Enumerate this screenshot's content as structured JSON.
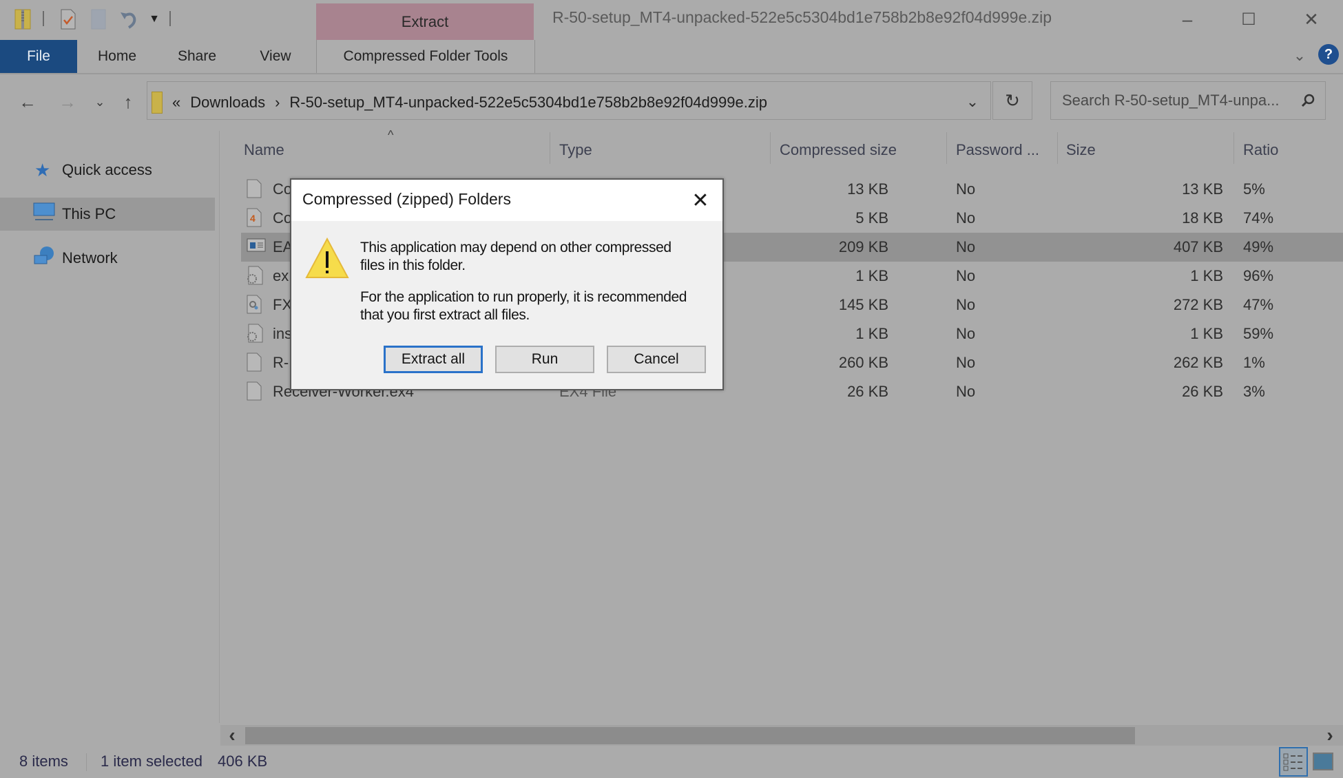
{
  "window": {
    "title": "R-50-setup_MT4-unpacked-522e5c5304bd1e758b2b8e92f04d999e.zip",
    "contextual_tab_group": "Extract",
    "controls": {
      "minimize": "–",
      "maximize": "☐",
      "close": "✕"
    }
  },
  "quick_access_toolbar": {
    "icons": [
      "zip-folder-icon",
      "properties-icon",
      "new-folder-icon",
      "undo-icon",
      "customize-dropdown-icon"
    ]
  },
  "ribbon": {
    "tabs": [
      {
        "label": "File",
        "active": true
      },
      {
        "label": "Home"
      },
      {
        "label": "Share"
      },
      {
        "label": "View"
      },
      {
        "label": "Compressed Folder Tools"
      }
    ],
    "expand_glyph": "⌄",
    "help_glyph": "?"
  },
  "navigation": {
    "back": "←",
    "forward": "→",
    "recent": "⌄",
    "up": "↑"
  },
  "address_bar": {
    "overflow": "«",
    "breadcrumbs": [
      "Downloads",
      "R-50-setup_MT4-unpacked-522e5c5304bd1e758b2b8e92f04d999e.zip"
    ],
    "separator": "›",
    "dropdown_glyph": "⌄",
    "refresh_glyph": "↻"
  },
  "search": {
    "placeholder": "Search R-50-setup_MT4-unpa...",
    "icon_glyph": "⚲"
  },
  "sidebar": {
    "items": [
      {
        "label": "Quick access",
        "icon": "star-icon"
      },
      {
        "label": "This PC",
        "icon": "computer-icon",
        "selected": true
      },
      {
        "label": "Network",
        "icon": "network-icon"
      }
    ]
  },
  "file_list": {
    "sort_indicator": "^",
    "columns": [
      "Name",
      "Type",
      "Compressed size",
      "Password ...",
      "Size",
      "Ratio"
    ],
    "rows": [
      {
        "name": "Co",
        "type": "",
        "compressed": "13 KB",
        "password": "No",
        "size": "13 KB",
        "ratio": "5%",
        "icon": "file-icon"
      },
      {
        "name": "Co",
        "type": "",
        "compressed": "5 KB",
        "password": "No",
        "size": "18 KB",
        "ratio": "74%",
        "icon": "mq4-file-icon"
      },
      {
        "name": "EA",
        "type": "",
        "compressed": "209 KB",
        "password": "No",
        "size": "407 KB",
        "ratio": "49%",
        "icon": "application-icon",
        "selected": true
      },
      {
        "name": "ex",
        "type": "",
        "compressed": "1 KB",
        "password": "No",
        "size": "1 KB",
        "ratio": "96%",
        "icon": "settings-file-icon"
      },
      {
        "name": "FX",
        "type": "",
        "compressed": "145 KB",
        "password": "No",
        "size": "272 KB",
        "ratio": "47%",
        "icon": "dll-file-icon"
      },
      {
        "name": "ins",
        "type": "",
        "compressed": "1 KB",
        "password": "No",
        "size": "1 KB",
        "ratio": "59%",
        "icon": "settings-file-icon"
      },
      {
        "name": "R-",
        "type": "",
        "compressed": "260 KB",
        "password": "No",
        "size": "262 KB",
        "ratio": "1%",
        "icon": "file-icon"
      },
      {
        "name": "Receiver-Worker.ex4",
        "type": "EX4 File",
        "compressed": "26 KB",
        "password": "No",
        "size": "26 KB",
        "ratio": "3%",
        "icon": "file-icon"
      }
    ]
  },
  "dialog": {
    "title": "Compressed (zipped) Folders",
    "close_glyph": "✕",
    "icon": "warning-icon",
    "message_line1": "This application may depend on other compressed",
    "message_line2": "files in this folder.",
    "message_line3": "For the application to run properly, it is recommended",
    "message_line4": "that you first extract all files.",
    "buttons": {
      "extract_all": "Extract all",
      "run": "Run",
      "cancel": "Cancel"
    }
  },
  "scrollbar": {
    "left_glyph": "‹",
    "right_glyph": "›"
  },
  "status_bar": {
    "item_count": "8 items",
    "selection": "1 item selected",
    "selection_size": "406 KB"
  }
}
